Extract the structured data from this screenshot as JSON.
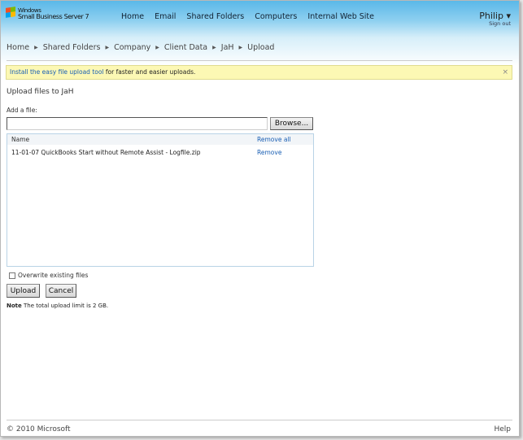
{
  "header": {
    "logo_line1": "Windows",
    "logo_line2": "Small Business Server 7",
    "nav": [
      "Home",
      "Email",
      "Shared Folders",
      "Computers",
      "Internal Web Site"
    ],
    "user": "Philip ▾",
    "sign_out": "Sign out"
  },
  "breadcrumb": [
    "Home",
    "Shared Folders",
    "Company",
    "Client Data",
    "JaH",
    "Upload"
  ],
  "banner": {
    "link": "Install the easy file upload tool",
    "text": " for faster and easier uploads.",
    "close": "×"
  },
  "page_title": "Upload files to JaH",
  "add_file_label": "Add a file:",
  "file_input_value": "",
  "browse_label": "Browse...",
  "list": {
    "header_name": "Name",
    "remove_all": "Remove all",
    "files": [
      {
        "name": "11-01-07 QuickBooks Start without Remote Assist - Logfile.zip",
        "action": "Remove"
      }
    ]
  },
  "overwrite_label": "Overwrite existing files",
  "upload_label": "Upload",
  "cancel_label": "Cancel",
  "note_bold": "Note",
  "note_text": " The total upload limit is 2 GB.",
  "footer": {
    "copyright": "© 2010 Microsoft",
    "help": "Help"
  }
}
